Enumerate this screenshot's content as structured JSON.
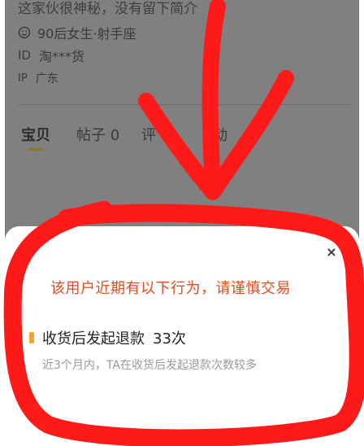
{
  "profile": {
    "bio": "这家伙很神秘，没有留下简介",
    "tags": "90后女生·射手座",
    "id_label": "ID",
    "id_value": "淘***货",
    "ip_label": "IP",
    "ip_value": "广东"
  },
  "tabs": [
    {
      "label": "宝贝"
    },
    {
      "label": "帖子 0"
    },
    {
      "label": "评"
    },
    {
      "label": "动"
    }
  ],
  "modal": {
    "close_label": "×",
    "title": "该用户近期有以下行为，请谨慎交易",
    "behavior_label": "收货后发起退款",
    "behavior_count": "33次",
    "behavior_desc": "近3个月内，TA在收货后发起退款次数较多"
  },
  "colors": {
    "warning_text": "#e64a1c",
    "marker_red": "#ff1a1a"
  }
}
